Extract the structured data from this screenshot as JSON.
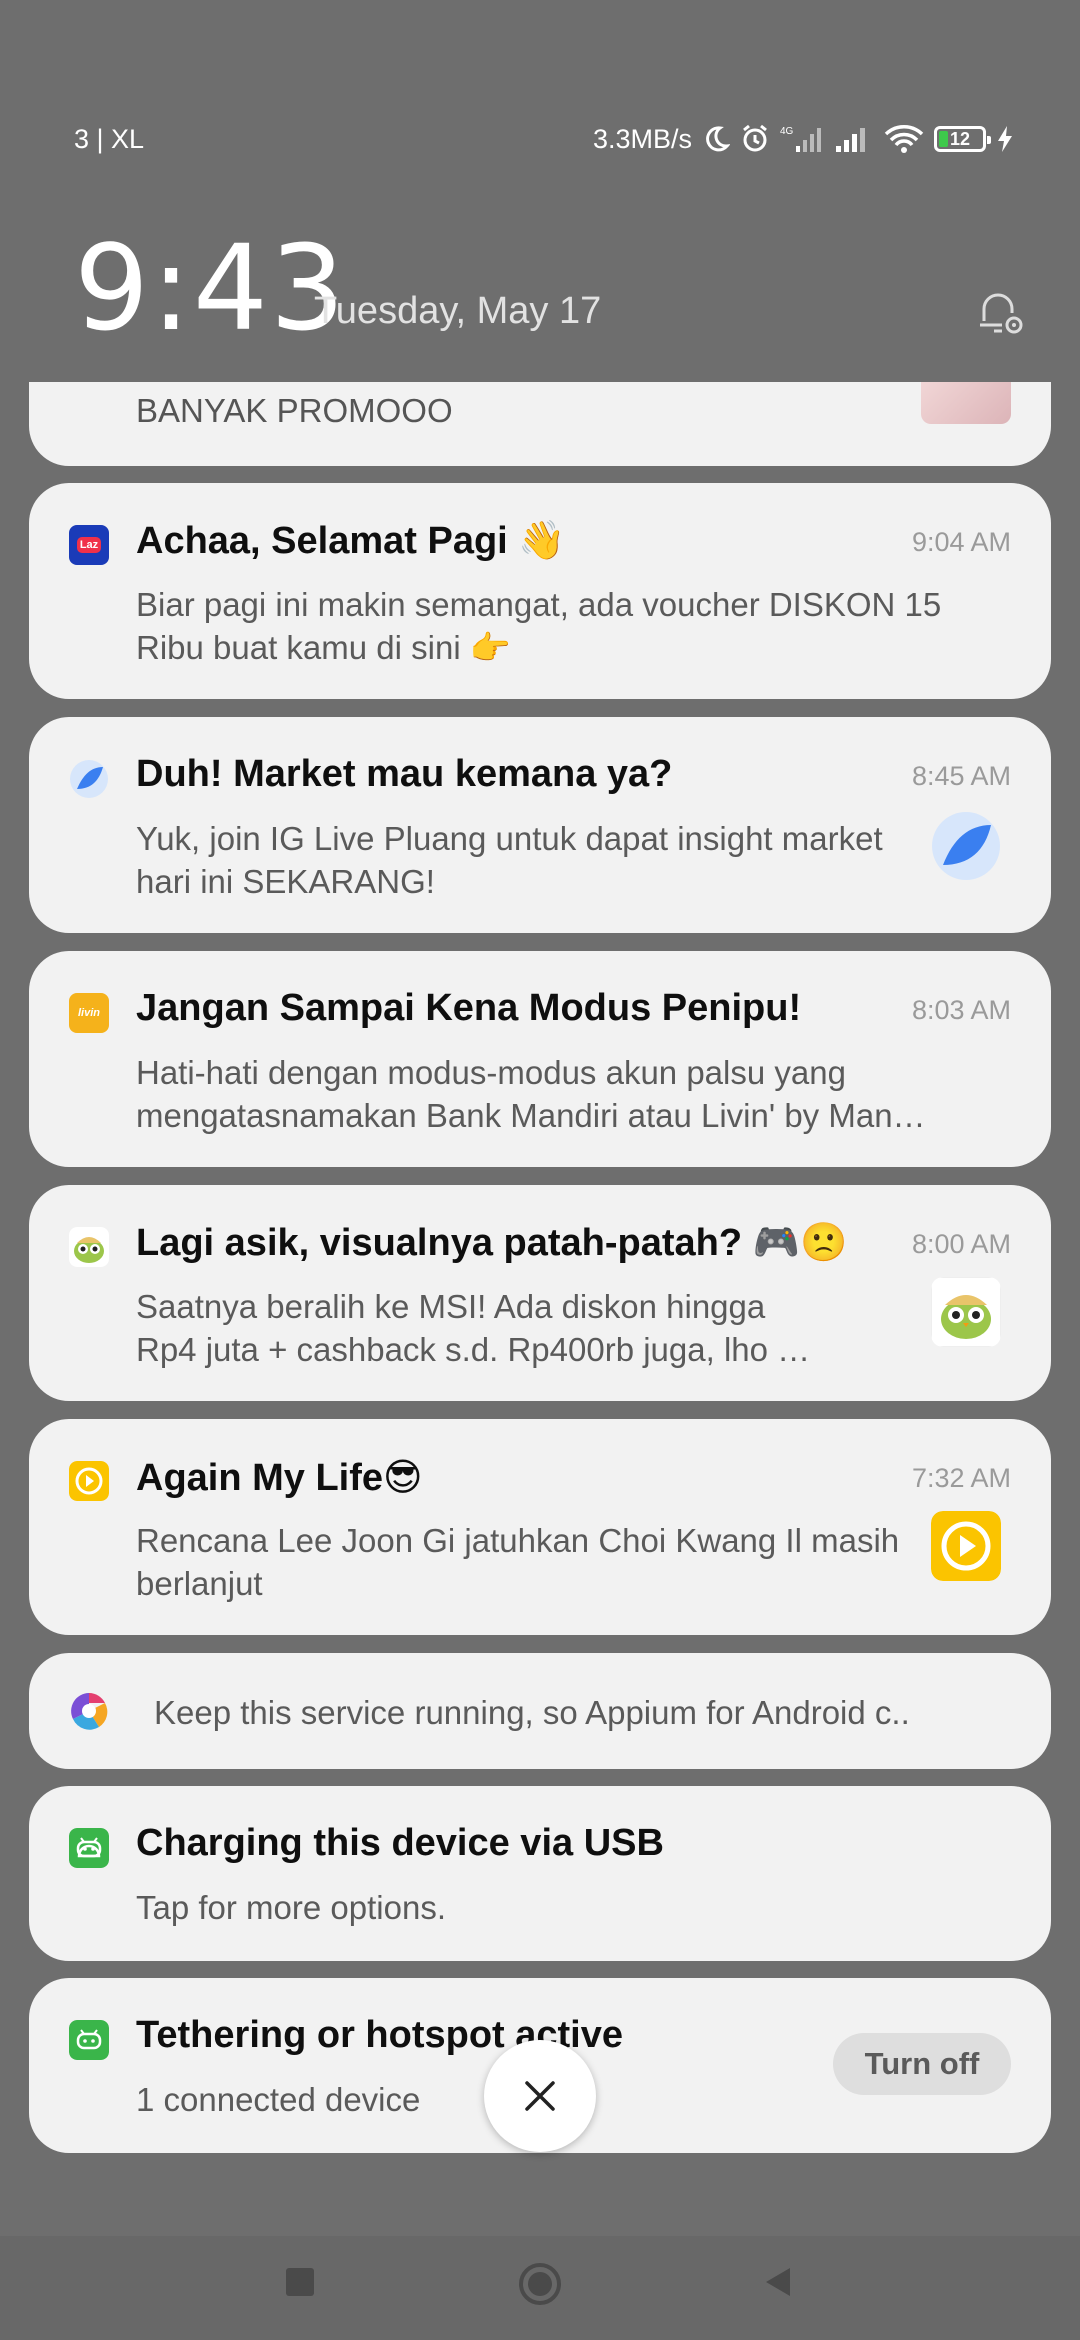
{
  "status_bar": {
    "carrier": "3 | XL",
    "speed": "3.3MB/s",
    "network_type": "4G",
    "battery_level": "12",
    "icons": [
      "moon-icon",
      "alarm-icon",
      "signal-4g-icon",
      "signal-icon",
      "wifi-icon",
      "battery-icon",
      "charging-bolt-icon"
    ]
  },
  "header": {
    "clock": "9:43",
    "date": "Tuesday, May 17",
    "settings_icon": "notification-settings-icon"
  },
  "notifications": [
    {
      "body": "BANYAK PROMOOO"
    },
    {
      "app": "Lazada",
      "icon_label": "Laz",
      "title": "Achaa, Selamat Pagi 👋",
      "time": "9:04 AM",
      "body": "Biar pagi ini makin semangat, ada voucher DISKON 15 Ribu buat kamu di sini 👉"
    },
    {
      "app": "Pluang",
      "title": "Duh! Market mau kemana ya?",
      "time": "8:45 AM",
      "body": "Yuk, join IG Live Pluang untuk dapat insight market hari ini SEKARANG!"
    },
    {
      "app": "Livin",
      "icon_label": "livin",
      "title": "Jangan Sampai Kena Modus Penipu!",
      "time": "8:03 AM",
      "body_line1": "Hati-hati dengan modus-modus akun palsu yang",
      "body_line2": "mengatasnamakan Bank Mandiri atau Livin' by Man…"
    },
    {
      "app": "Tokopedia",
      "title": "Lagi asik, visualnya patah-patah? 🎮🙁",
      "time": "8:00 AM",
      "body_line1": "Saatnya beralih ke MSI! Ada diskon hingga",
      "body_line2": "Rp4 juta + cashback s.d. Rp400rb juga, lho …"
    },
    {
      "app": "Video",
      "title": "Again My Life😎",
      "time": "7:32 AM",
      "body": "Rencana Lee Joon Gi jatuhkan Choi Kwang Il masih berlanjut"
    },
    {
      "app": "Appium",
      "body": "Keep this service running, so Appium for Android c.."
    },
    {
      "app": "Android System",
      "title": "Charging this device via USB",
      "body": "Tap for more options."
    },
    {
      "app": "Android System",
      "title": "Tethering or hotspot active",
      "body": "1 connected device",
      "action": "Turn off"
    }
  ],
  "colors": {
    "background": "#6e6e6e",
    "card": "#f2f2f2",
    "lazada": "#1a3bb8",
    "livin": "#f5b21b",
    "video": "#fbc400",
    "android": "#3ab54a"
  }
}
